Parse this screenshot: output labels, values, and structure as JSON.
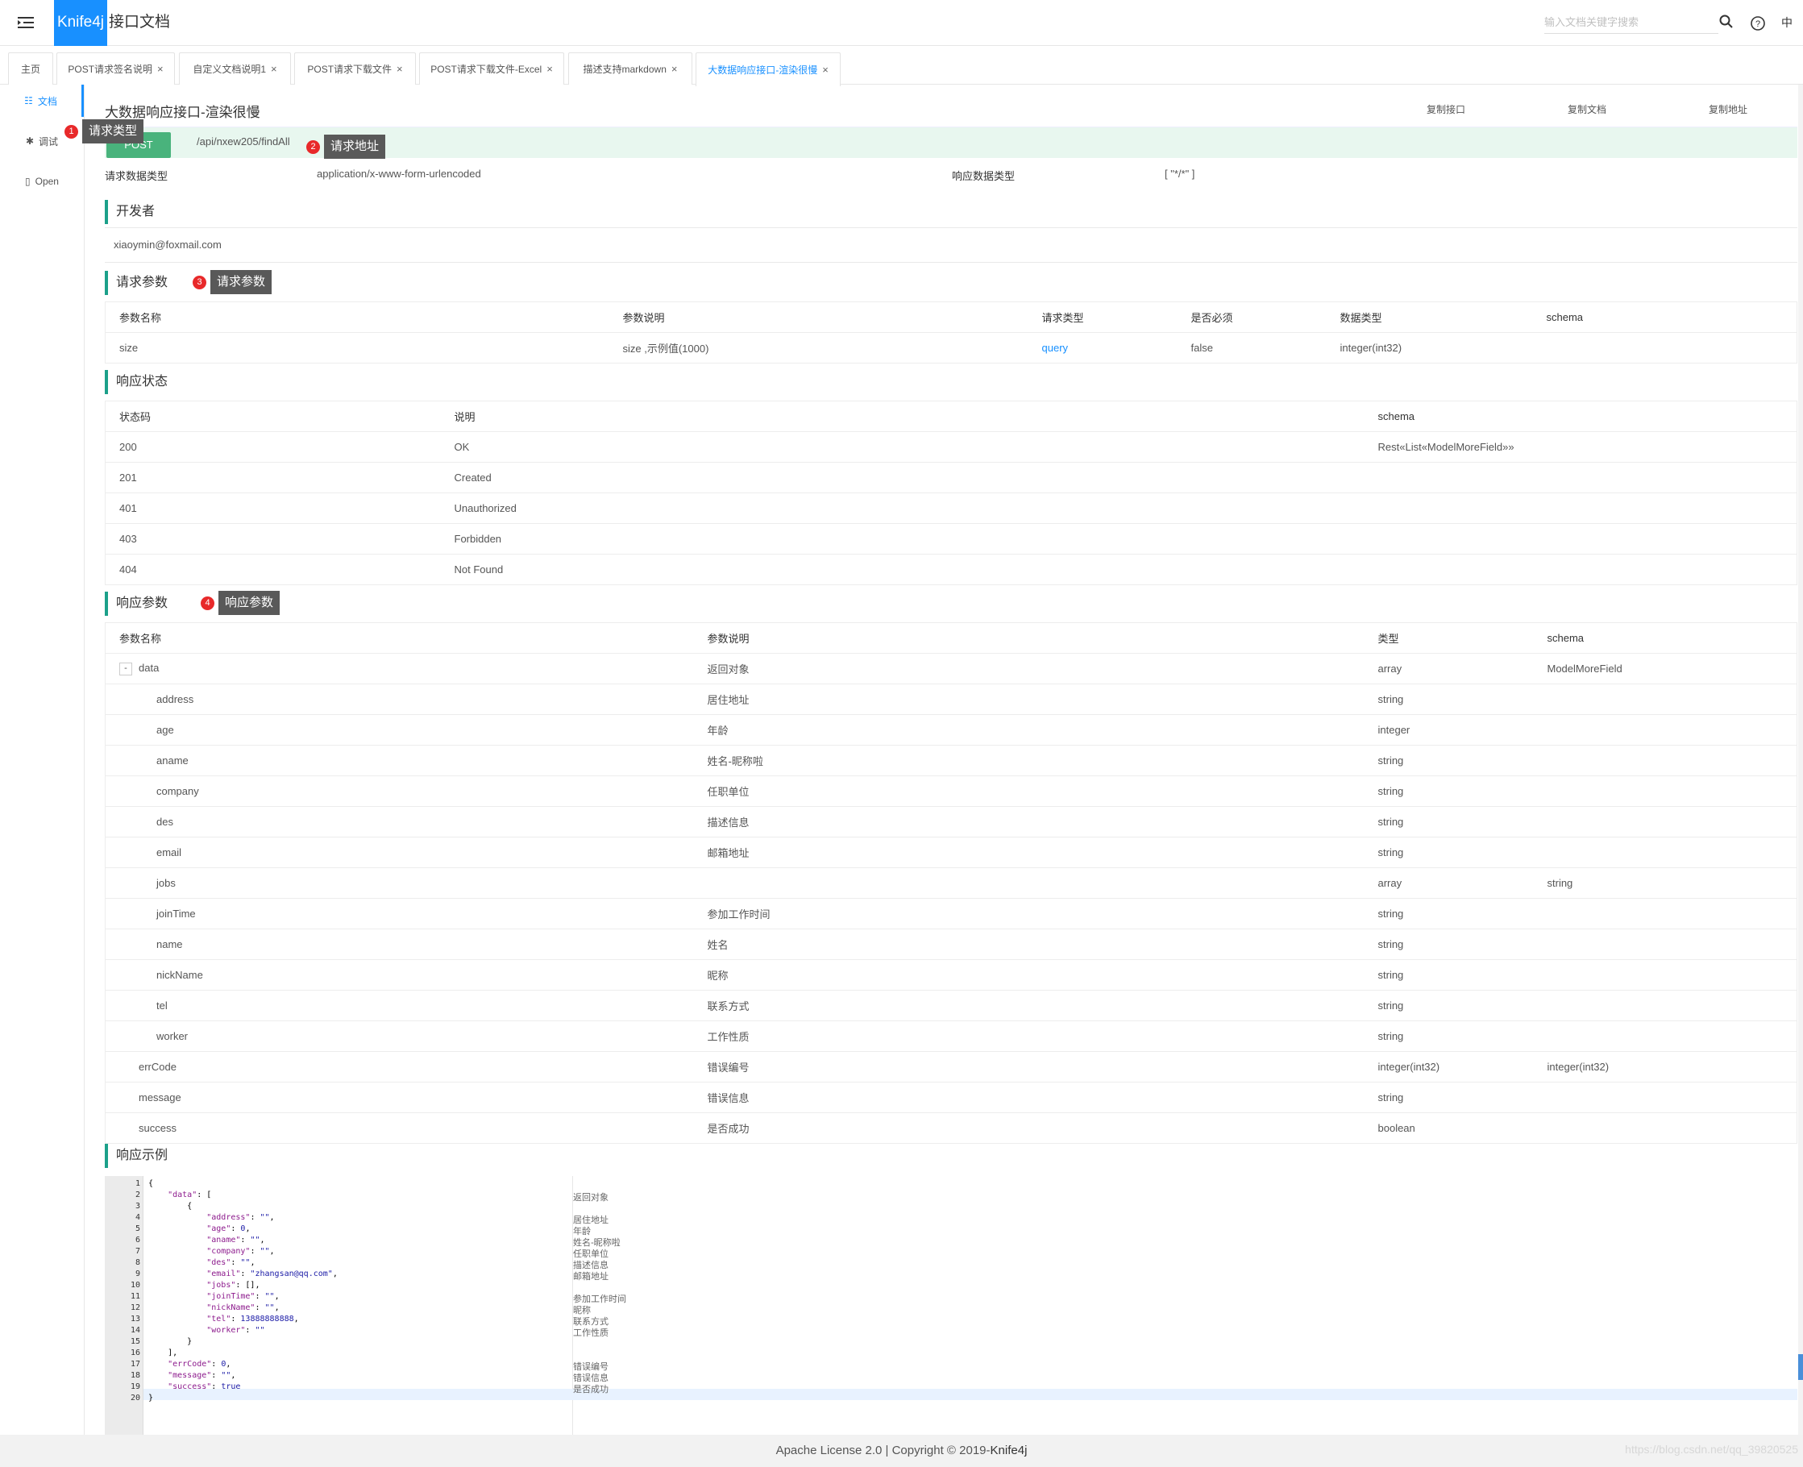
{
  "header": {
    "logo": "Knife4j",
    "title": "接口文档",
    "search_placeholder": "输入文档关键字搜索",
    "lang": "中"
  },
  "tabs": [
    {
      "label": "主页",
      "closable": false
    },
    {
      "label": "POST请求签名说明",
      "closable": true
    },
    {
      "label": "自定义文档说明1",
      "closable": true
    },
    {
      "label": "POST请求下载文件",
      "closable": true
    },
    {
      "label": "POST请求下载文件-Excel",
      "closable": true
    },
    {
      "label": "描述支持markdown",
      "closable": true
    },
    {
      "label": "大数据响应接口-渲染很慢",
      "closable": true,
      "active": true
    }
  ],
  "sidebar": {
    "items": [
      {
        "label": "文档",
        "icon": "doc-icon"
      },
      {
        "label": "调试",
        "icon": "bug-icon"
      },
      {
        "label": "Open",
        "icon": "file-icon"
      }
    ]
  },
  "api": {
    "title": "大数据响应接口-渲染很慢",
    "copy_api": "复制接口",
    "copy_doc": "复制文档",
    "copy_url": "复制地址",
    "method": "POST",
    "url": "/api/nxew205/findAll",
    "req_type_label": "请求数据类型",
    "req_type": "application/x-www-form-urlencoded",
    "resp_type_label": "响应数据类型",
    "resp_type": "[ \"*/*\" ]"
  },
  "developer": {
    "title": "开发者",
    "email": "xiaoymin@foxmail.com"
  },
  "request_params": {
    "title": "请求参数",
    "headers": [
      "参数名称",
      "参数说明",
      "请求类型",
      "是否必须",
      "数据类型",
      "schema"
    ],
    "rows": [
      [
        "size",
        "size ,示例值(1000)",
        "query",
        "false",
        "integer(int32)",
        ""
      ]
    ]
  },
  "response_status": {
    "title": "响应状态",
    "headers": [
      "状态码",
      "说明",
      "schema"
    ],
    "rows": [
      [
        "200",
        "OK",
        "Rest«List«ModelMoreField»»"
      ],
      [
        "201",
        "Created",
        ""
      ],
      [
        "401",
        "Unauthorized",
        ""
      ],
      [
        "403",
        "Forbidden",
        ""
      ],
      [
        "404",
        "Not Found",
        ""
      ]
    ]
  },
  "response_params": {
    "title": "响应参数",
    "headers": [
      "参数名称",
      "参数说明",
      "类型",
      "schema"
    ],
    "rows": [
      {
        "name": "data",
        "desc": "返回对象",
        "type": "array",
        "schema": "ModelMoreField",
        "level": 0,
        "toggle": "-"
      },
      {
        "name": "address",
        "desc": "居住地址",
        "type": "string",
        "schema": "",
        "level": 2
      },
      {
        "name": "age",
        "desc": "年龄",
        "type": "integer",
        "schema": "",
        "level": 2
      },
      {
        "name": "aname",
        "desc": "姓名-昵称啦",
        "type": "string",
        "schema": "",
        "level": 2
      },
      {
        "name": "company",
        "desc": "任职单位",
        "type": "string",
        "schema": "",
        "level": 2
      },
      {
        "name": "des",
        "desc": "描述信息",
        "type": "string",
        "schema": "",
        "level": 2
      },
      {
        "name": "email",
        "desc": "邮箱地址",
        "type": "string",
        "schema": "",
        "level": 2
      },
      {
        "name": "jobs",
        "desc": "",
        "type": "array",
        "schema": "string",
        "level": 2
      },
      {
        "name": "joinTime",
        "desc": "参加工作时间",
        "type": "string",
        "schema": "",
        "level": 2
      },
      {
        "name": "name",
        "desc": "姓名",
        "type": "string",
        "schema": "",
        "level": 2
      },
      {
        "name": "nickName",
        "desc": "昵称",
        "type": "string",
        "schema": "",
        "level": 2
      },
      {
        "name": "tel",
        "desc": "联系方式",
        "type": "string",
        "schema": "",
        "level": 2
      },
      {
        "name": "worker",
        "desc": "工作性质",
        "type": "string",
        "schema": "",
        "level": 2
      },
      {
        "name": "errCode",
        "desc": "错误编号",
        "type": "integer(int32)",
        "schema": "integer(int32)",
        "level": 1
      },
      {
        "name": "message",
        "desc": "错误信息",
        "type": "string",
        "schema": "",
        "level": 1
      },
      {
        "name": "success",
        "desc": "是否成功",
        "type": "boolean",
        "schema": "",
        "level": 1
      }
    ]
  },
  "example": {
    "title": "响应示例",
    "lines": [
      {
        "n": "1",
        "code": "{",
        "comment": ""
      },
      {
        "n": "2",
        "code": "    \"data\": [",
        "comment": "返回对象"
      },
      {
        "n": "3",
        "code": "        {",
        "comment": ""
      },
      {
        "n": "4",
        "code": "            \"address\": \"\",",
        "comment": "居住地址"
      },
      {
        "n": "5",
        "code": "            \"age\": 0,",
        "comment": "年龄"
      },
      {
        "n": "6",
        "code": "            \"aname\": \"\",",
        "comment": "姓名-昵称啦"
      },
      {
        "n": "7",
        "code": "            \"company\": \"\",",
        "comment": "任职单位"
      },
      {
        "n": "8",
        "code": "            \"des\": \"\",",
        "comment": "描述信息"
      },
      {
        "n": "9",
        "code": "            \"email\": \"zhangsan@qq.com\",",
        "comment": "邮箱地址"
      },
      {
        "n": "10",
        "code": "            \"jobs\": [],",
        "comment": ""
      },
      {
        "n": "11",
        "code": "            \"joinTime\": \"\",",
        "comment": "参加工作时间"
      },
      {
        "n": "12",
        "code": "            \"nickName\": \"\",",
        "comment": "昵称"
      },
      {
        "n": "13",
        "code": "            \"tel\": 13888888888,",
        "comment": "联系方式"
      },
      {
        "n": "14",
        "code": "            \"worker\": \"\"",
        "comment": "工作性质"
      },
      {
        "n": "15",
        "code": "        }",
        "comment": ""
      },
      {
        "n": "16",
        "code": "    ],",
        "comment": ""
      },
      {
        "n": "17",
        "code": "    \"errCode\": 0,",
        "comment": "错误编号"
      },
      {
        "n": "18",
        "code": "    \"message\": \"\",",
        "comment": "错误信息"
      },
      {
        "n": "19",
        "code": "    \"success\": true",
        "comment": "是否成功"
      },
      {
        "n": "20",
        "code": "}",
        "comment": ""
      }
    ]
  },
  "annotations": [
    {
      "num": "1",
      "label": "请求类型"
    },
    {
      "num": "2",
      "label": "请求地址"
    },
    {
      "num": "3",
      "label": "请求参数"
    },
    {
      "num": "4",
      "label": "响应参数"
    }
  ],
  "footer": {
    "text": "Apache License 2.0 | Copyright © 2019-",
    "brand": "Knife4j"
  },
  "watermark": "https://blog.csdn.net/qq_39820525",
  "colors": {
    "accent": "#1890ff",
    "section": "#1ca08a",
    "method": "#49b37c",
    "url_bg": "#e8f7ef"
  }
}
